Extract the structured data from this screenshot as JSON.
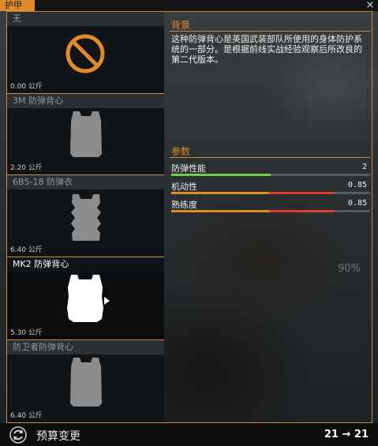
{
  "window": {
    "title": "护甲",
    "close": "×"
  },
  "armor_list": [
    {
      "name": "无",
      "weight": "0.00 公斤",
      "icon": "none-icon",
      "selected": false
    },
    {
      "name": "3M 防弹背心",
      "weight": "2.20 公斤",
      "icon": "vest-icon",
      "selected": false
    },
    {
      "name": "6B5-18 防弹衣",
      "weight": "6.40 公斤",
      "icon": "armor-vest-icon",
      "selected": false
    },
    {
      "name": "MK2 防弹背心",
      "weight": "5.30 公斤",
      "icon": "vest-icon",
      "selected": true
    },
    {
      "name": "防卫者防弹背心",
      "weight": "6.40 公斤",
      "icon": "vest-icon",
      "selected": false
    }
  ],
  "details": {
    "background_title": "背景",
    "background_text": "这种防弹背心是英国武装部队所使用的身体防护系统的一部分。是根据前线实战经验观察后所改良的第二代版本。",
    "params_title": "参数",
    "stats": [
      {
        "label": "防弹性能",
        "value": "2",
        "fill": 0.5,
        "color": "#6bd04a"
      },
      {
        "label": "机动性",
        "value": "0.85",
        "fill": 0.82,
        "color": "#d9402a",
        "accent": "#e08a2a"
      },
      {
        "label": "熟练度",
        "value": "0.85",
        "fill": 0.82,
        "color": "#d9402a",
        "accent": "#e08a2a"
      }
    ]
  },
  "overlay_percent": "90%",
  "footer": {
    "budget_label": "预算变更",
    "budget_value": "21 → 21",
    "icon": "budget-refresh-icon"
  },
  "colors": {
    "accent": "#e08a2a",
    "border": "#c98a3b",
    "good": "#6bd04a",
    "bad": "#d9402a"
  }
}
